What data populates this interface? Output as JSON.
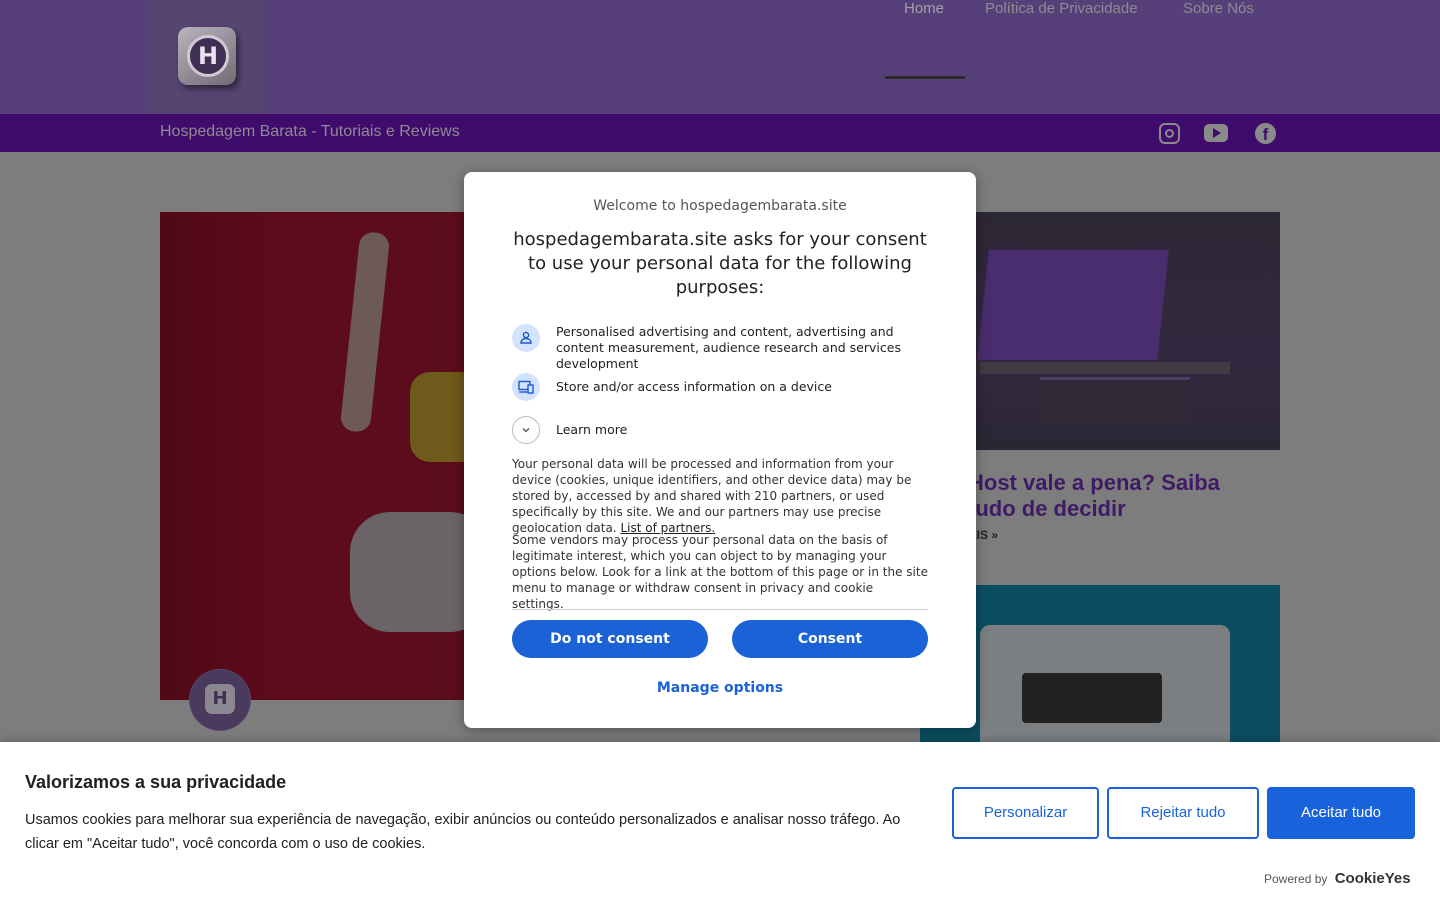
{
  "header": {
    "logo_letter": "H",
    "nav": [
      {
        "label": "Home"
      },
      {
        "label": "Política de Privacidade"
      },
      {
        "label": "Sobre Nós"
      }
    ]
  },
  "subbar": {
    "title": "Hospedagem Barata - Tutoriais e Reviews",
    "social": [
      "instagram-icon",
      "youtube-icon",
      "facebook-icon"
    ]
  },
  "content": {
    "avatar_letter": "H",
    "card1_title": "Host vale a pena? Saiba tudo  de decidir",
    "card1_more": "AIS »"
  },
  "consent": {
    "welcome": "Welcome to hospedagembarata.site",
    "heading": "hospedagembarata.site asks for your consent to use your personal data for the following purposes:",
    "purposes": [
      {
        "icon": "person-icon",
        "text": "Personalised advertising and content, advertising and content measurement, audience research and services development"
      },
      {
        "icon": "devices-icon",
        "text": "Store and/or access information on a device"
      }
    ],
    "learn_more": "Learn more",
    "para1": "Your personal data will be processed and information from your device (cookies, unique identifiers, and other device data) may be stored by, accessed by and shared with 210 partners, or used specifically by this site. We and our partners may use precise geolocation data.",
    "partners_link": "List of partners.",
    "para2": "Some vendors may process your personal data on the basis of legitimate interest, which you can object to by managing your options below. Look for a link at the bottom of this page or in the site menu to manage or withdraw consent in privacy and cookie settings.",
    "do_not_consent": "Do not consent",
    "consent_btn": "Consent",
    "manage_options": "Manage options"
  },
  "cookiebar": {
    "title": "Valorizamos a sua privacidade",
    "text": "Usamos cookies para melhorar sua experiência de navegação, exibir anúncios ou conteúdo personalizados e analisar nosso tráfego. Ao clicar em \"Aceitar tudo\", você concorda com o uso de cookies.",
    "customize": "Personalizar",
    "reject": "Rejeitar tudo",
    "accept": "Aceitar tudo",
    "powered_by": "Powered by",
    "brand": "CookieYes",
    "accent": "#1863dc"
  }
}
